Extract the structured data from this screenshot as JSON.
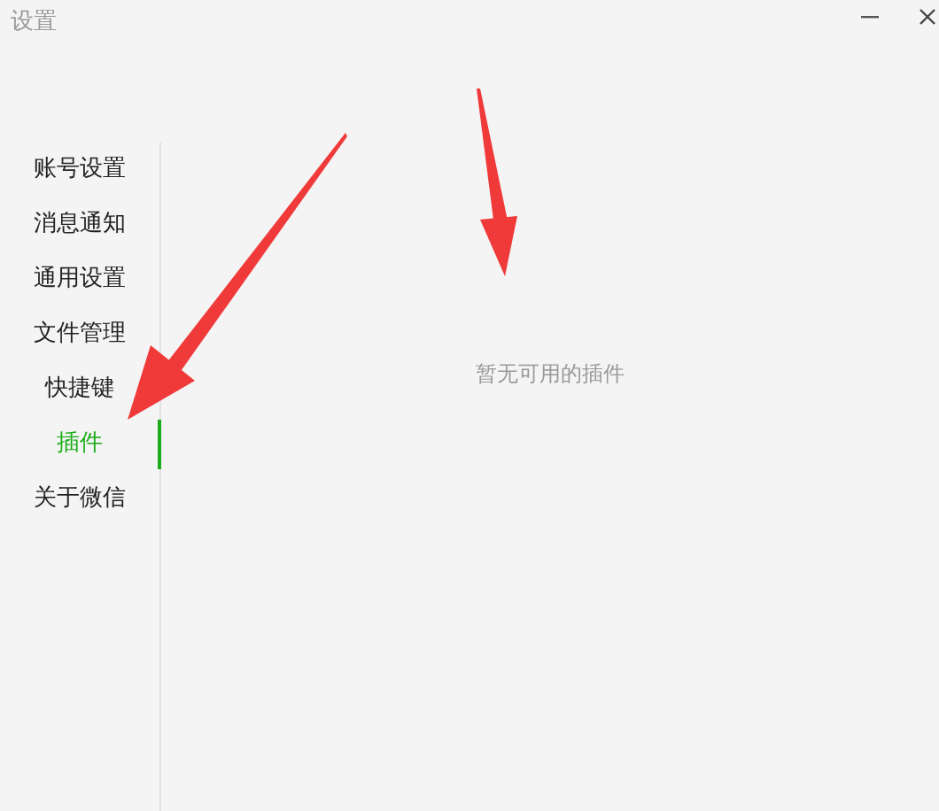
{
  "window": {
    "title": "设置"
  },
  "sidebar": {
    "items": [
      {
        "label": "账号设置",
        "selected": false
      },
      {
        "label": "消息通知",
        "selected": false
      },
      {
        "label": "通用设置",
        "selected": false
      },
      {
        "label": "文件管理",
        "selected": false
      },
      {
        "label": "快捷键",
        "selected": false
      },
      {
        "label": "插件",
        "selected": true
      },
      {
        "label": "关于微信",
        "selected": false
      }
    ]
  },
  "content": {
    "empty_message": "暂无可用的插件"
  }
}
